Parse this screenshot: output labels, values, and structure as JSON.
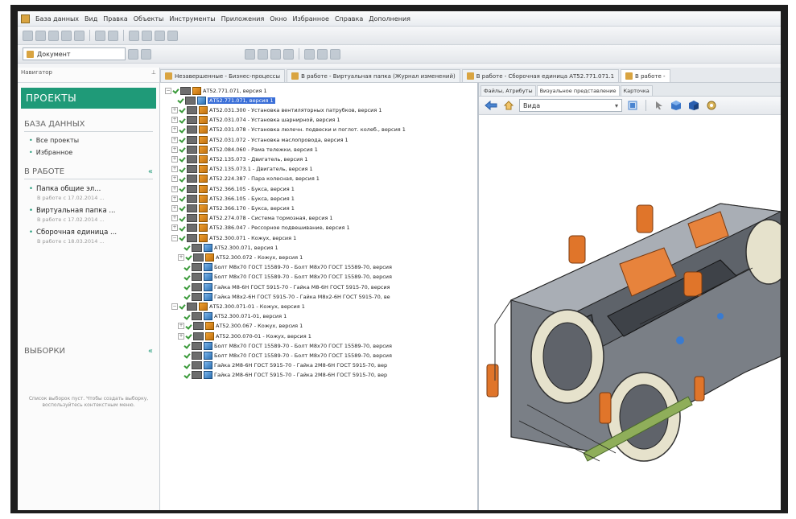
{
  "menu": [
    "База данных",
    "Вид",
    "Правка",
    "Объекты",
    "Инструменты",
    "Приложения",
    "Окно",
    "Избранное",
    "Справка",
    "Дополнения"
  ],
  "toolbar": {
    "document_combo": "Документ"
  },
  "navigator": {
    "title": "Навигатор",
    "pin": "⊥"
  },
  "sidebar": {
    "projects": "ПРОЕКТЫ",
    "database": "БАЗА ДАННЫХ",
    "links": [
      "Все проекты",
      "Избранное"
    ],
    "in_work": "В РАБОТЕ",
    "in_work_collapse": "«",
    "work_items": [
      {
        "title": "Папка общие эл...",
        "sub": "В работе с 17.02.2014 ..."
      },
      {
        "title": "Виртуальная папка ...",
        "sub": "В работе с 17.02.2014 ..."
      },
      {
        "title": "Сборочная единица ...",
        "sub": "В работе с 18.03.2014 ..."
      }
    ],
    "selections": "ВЫБОРКИ",
    "selections_collapse": "«",
    "empty_msg": "Список выборок пуст. Чтобы создать выборку, воспользуйтесь контекстным меню."
  },
  "tabs": [
    "Незавершенные - Бизнес-процессы",
    "В работе - Виртуальная папка (Журнал изменений)",
    "В работе - Сборочная единица АТ52.771.071.1",
    "В работе -"
  ],
  "tree": [
    {
      "level": 0,
      "exp": "−",
      "icon": "asm",
      "text": "АТ52.771.071, версия 1"
    },
    {
      "level": 1,
      "exp": "",
      "icon": "prt",
      "text": "АТ52.771.071, версия 1",
      "selected": true
    },
    {
      "level": 1,
      "exp": "+",
      "icon": "asm",
      "text": "АТ52.031.300 - Установка вентиляторных патрубков, версия 1"
    },
    {
      "level": 1,
      "exp": "+",
      "icon": "asm",
      "text": "АТ52.031.074 - Установка шарнирной, версия 1"
    },
    {
      "level": 1,
      "exp": "+",
      "icon": "asm",
      "text": "АТ52.031.078 - Установка люлечн. подвески и поглот. колеб., версия 1"
    },
    {
      "level": 1,
      "exp": "+",
      "icon": "asm",
      "text": "АТ52.031.072 - Установка маслопровода, версия 1"
    },
    {
      "level": 1,
      "exp": "+",
      "icon": "asm",
      "text": "АТ52.084.060 - Рама тележки, версия 1"
    },
    {
      "level": 1,
      "exp": "+",
      "icon": "asm",
      "text": "АТ52.135.073 - Двигатель, версия 1"
    },
    {
      "level": 1,
      "exp": "+",
      "icon": "asm",
      "text": "АТ52.135.073.1 - Двигатель, версия 1"
    },
    {
      "level": 1,
      "exp": "+",
      "icon": "asm",
      "text": "АТ52.224.387 - Пара колесная, версия 1"
    },
    {
      "level": 1,
      "exp": "+",
      "icon": "asm",
      "text": "АТ52.366.105 - Букса, версия 1"
    },
    {
      "level": 1,
      "exp": "+",
      "icon": "asm",
      "text": "АТ52.366.105 - Букса, версия 1"
    },
    {
      "level": 1,
      "exp": "+",
      "icon": "asm",
      "text": "АТ52.366.170 - Букса, версия 1"
    },
    {
      "level": 1,
      "exp": "+",
      "icon": "asm",
      "text": "АТ52.274.078 - Система тормозная, версия 1"
    },
    {
      "level": 1,
      "exp": "+",
      "icon": "asm",
      "text": "АТ52.386.047 - Рессорное подвешивание, версия 1"
    },
    {
      "level": 1,
      "exp": "−",
      "icon": "asm",
      "text": "АТ52.300.071 - Кожух, версия 1"
    },
    {
      "level": 2,
      "exp": "",
      "icon": "prt",
      "text": "АТ52.300.071, версия 1"
    },
    {
      "level": 2,
      "exp": "+",
      "icon": "asm",
      "text": "АТ52.300.072 - Кожух, версия 1"
    },
    {
      "level": 2,
      "exp": "",
      "icon": "prt",
      "text": "Болт М8х70 ГОСТ 15589-70 - Болт М8х70 ГОСТ 15589-70, версия"
    },
    {
      "level": 2,
      "exp": "",
      "icon": "prt",
      "text": "Болт М8х70 ГОСТ 15589-70 - Болт М8х70 ГОСТ 15589-70, версия"
    },
    {
      "level": 2,
      "exp": "",
      "icon": "prt",
      "text": "Гайка М8-6Н ГОСТ 5915-70 - Гайка М8-6Н ГОСТ 5915-70, версия"
    },
    {
      "level": 2,
      "exp": "",
      "icon": "prt",
      "text": "Гайка М8х2-6Н ГОСТ 5915-70 - Гайка М8х2-6Н ГОСТ 5915-70, ве"
    },
    {
      "level": 1,
      "exp": "−",
      "icon": "asm",
      "text": "АТ52.300.071-01 - Кожух, версия 1"
    },
    {
      "level": 2,
      "exp": "",
      "icon": "prt",
      "text": "АТ52.300.071-01, версия 1"
    },
    {
      "level": 2,
      "exp": "+",
      "icon": "asm",
      "text": "АТ52.300.067 - Кожух, версия 1"
    },
    {
      "level": 2,
      "exp": "+",
      "icon": "asm",
      "text": "АТ52.300.070-01 - Кожух, версия 1"
    },
    {
      "level": 2,
      "exp": "",
      "icon": "prt",
      "text": "Болт М8х70 ГОСТ 15589-70 - Болт М8х70 ГОСТ 15589-70, версия"
    },
    {
      "level": 2,
      "exp": "",
      "icon": "prt",
      "text": "Болт М8х70 ГОСТ 15589-70 - Болт М8х70 ГОСТ 15589-70, версия"
    },
    {
      "level": 2,
      "exp": "",
      "icon": "prt",
      "text": "Гайка 2М8-6Н ГОСТ 5915-70 - Гайка 2М8-6Н ГОСТ 5915-70, вер"
    },
    {
      "level": 2,
      "exp": "",
      "icon": "prt",
      "text": "Гайка 2М8-6Н ГОСТ 5915-70 - Гайка 2М8-6Н ГОСТ 5915-70, вер"
    }
  ],
  "right": {
    "tabs": [
      "Файлы, Атрибуты",
      "Визуальное представление",
      "Карточка"
    ],
    "view_combo": "Вида"
  },
  "colors": {
    "accent": "#1f9a78",
    "selection": "#3a6fd8",
    "bogie_orange": "#e0752a"
  }
}
